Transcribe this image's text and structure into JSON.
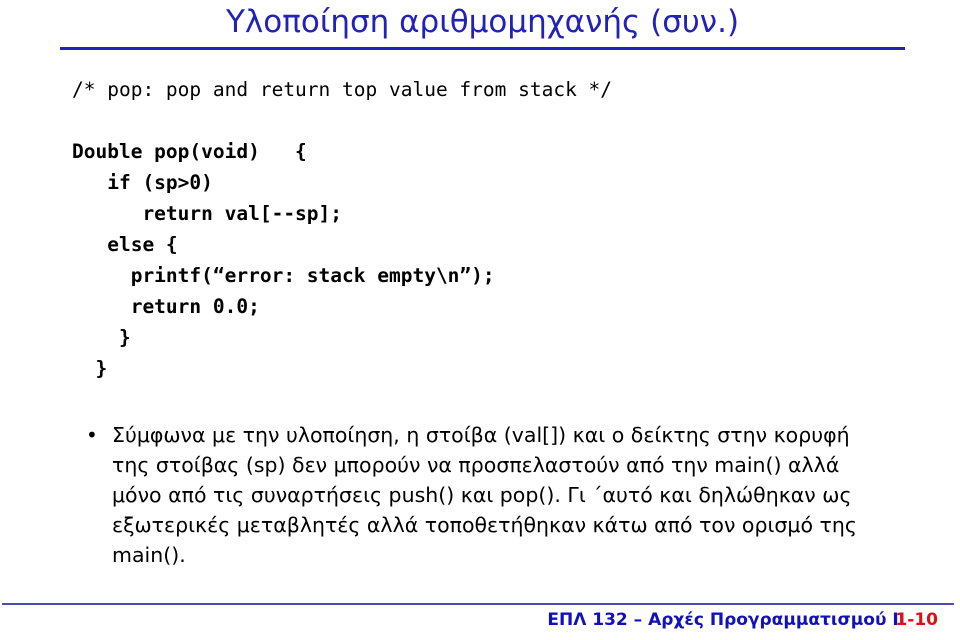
{
  "slide": {
    "title": "Υλοποίηση αριθμομηχανής (συν.)",
    "title_color": "#2222bb",
    "background_color": "#ffffff"
  },
  "code": {
    "language": "c",
    "lines": [
      {
        "text": "/* pop: pop and return top value from stack */",
        "bold": false
      },
      {
        "text": "",
        "bold": false
      },
      {
        "text": "Double pop(void)   {",
        "bold": true
      },
      {
        "text": "   if (sp>0)",
        "bold": true
      },
      {
        "text": "      return val[--sp];",
        "bold": true
      },
      {
        "text": "   else {",
        "bold": true
      },
      {
        "text": "     printf(“error: stack empty\\n”);",
        "bold": true
      },
      {
        "text": "     return 0.0;",
        "bold": true
      },
      {
        "text": "    }",
        "bold": true
      },
      {
        "text": "  }",
        "bold": true
      }
    ]
  },
  "body": {
    "bullet_marker": "•",
    "text": "Σύμφωνα με την υλοποίηση, η στοίβα (val[]) και ο δείκτης στην κορυφή της στοίβας (sp) δεν μπορούν να προσπελαστούν από την main() αλλά μόνο από τις συναρτήσεις push() και pop(). Γι ΄αυτό και δηλώθηκαν ως εξωτερικές μεταβλητές αλλά τοποθετήθηκαν κάτω από τον ορισμό της main()."
  },
  "footer": {
    "course": "ΕΠΛ 132 – Αρχές Προγραμματισμού ΙΙ",
    "course_color": "#1111bb",
    "page": "1-10",
    "page_color": "#dd1111"
  }
}
